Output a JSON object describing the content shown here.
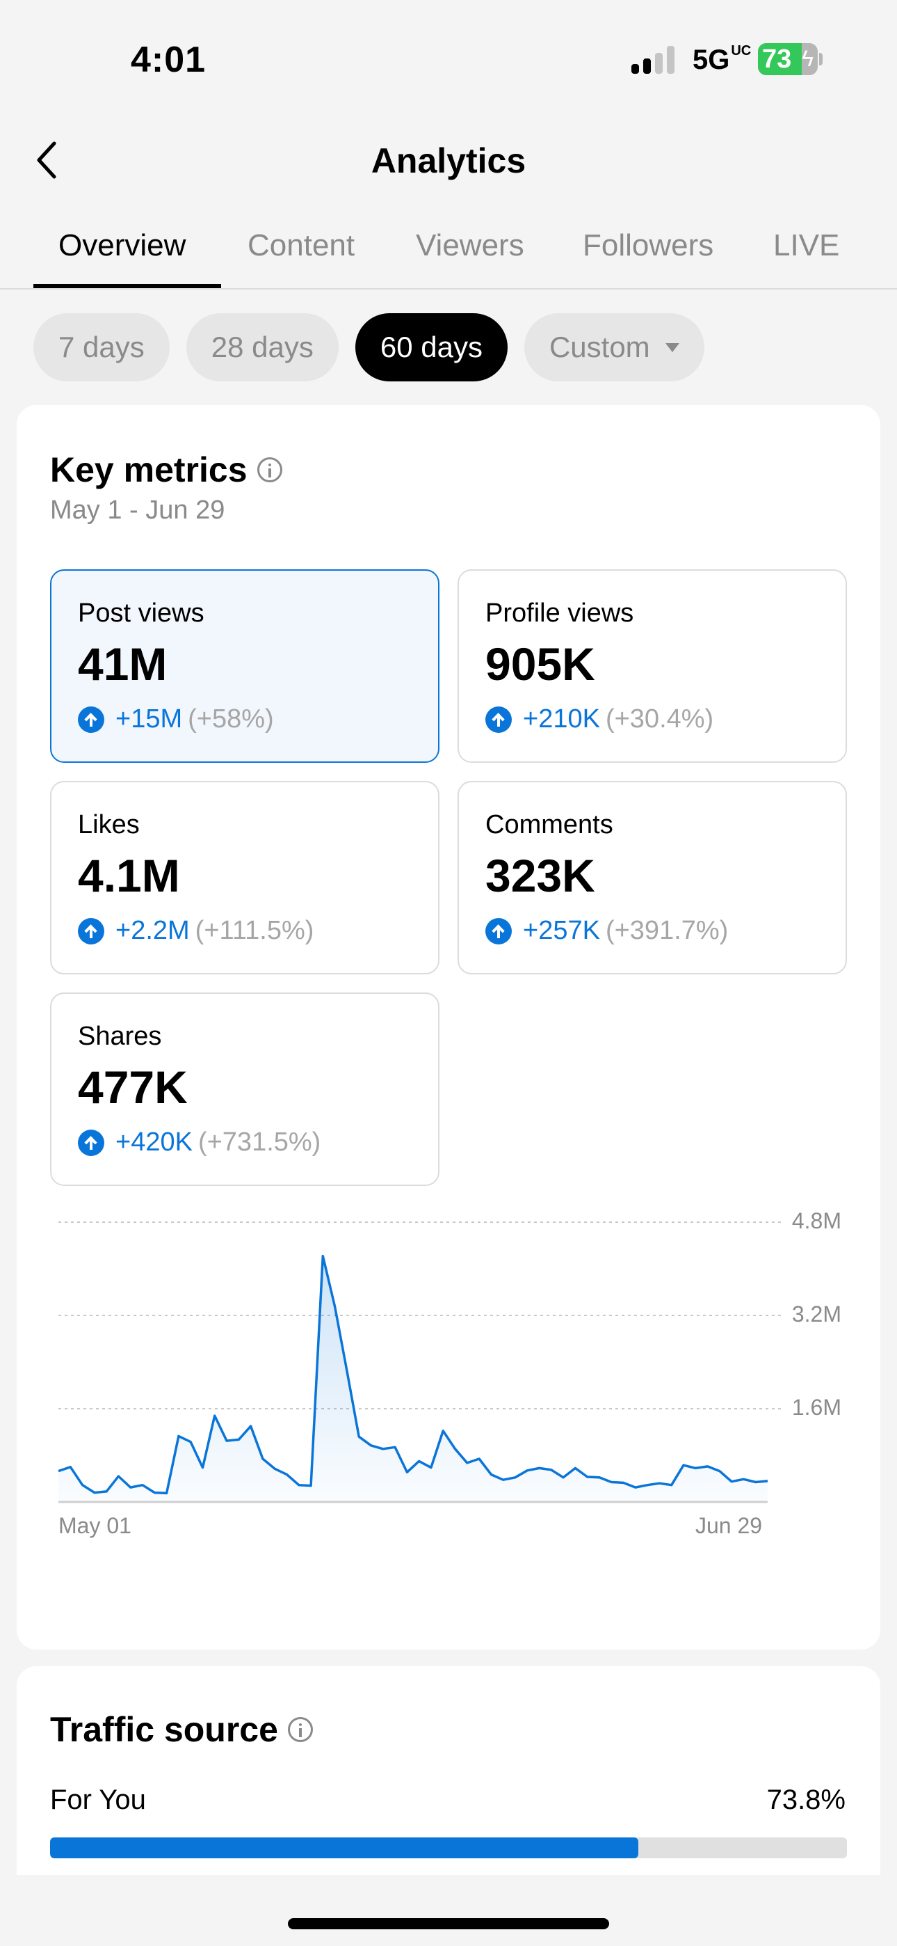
{
  "status_bar": {
    "time": "4:01",
    "network": "5G",
    "network_suffix": "UC",
    "battery_percent": 73,
    "battery_label": "73",
    "charging": true,
    "signal_bars_active": 2,
    "signal_bars_total": 4
  },
  "nav": {
    "title": "Analytics",
    "back_icon": "chevron-left-icon"
  },
  "tabs": [
    {
      "label": "Overview",
      "active": true
    },
    {
      "label": "Content",
      "active": false
    },
    {
      "label": "Viewers",
      "active": false
    },
    {
      "label": "Followers",
      "active": false
    },
    {
      "label": "LIVE",
      "active": false
    }
  ],
  "date_filters": [
    {
      "label": "7 days",
      "active": false
    },
    {
      "label": "28 days",
      "active": false
    },
    {
      "label": "60 days",
      "active": true
    },
    {
      "label": "Custom",
      "active": false,
      "dropdown": true
    }
  ],
  "key_metrics": {
    "title": "Key metrics",
    "date_range": "May 1 - Jun 29",
    "metrics": [
      {
        "label": "Post views",
        "value": "41M",
        "delta": "+15M",
        "delta_pct": "(+58%)",
        "selected": true
      },
      {
        "label": "Profile views",
        "value": "905K",
        "delta": "+210K",
        "delta_pct": "(+30.4%)",
        "selected": false
      },
      {
        "label": "Likes",
        "value": "4.1M",
        "delta": "+2.2M",
        "delta_pct": "(+111.5%)",
        "selected": false
      },
      {
        "label": "Comments",
        "value": "323K",
        "delta": "+257K",
        "delta_pct": "(+391.7%)",
        "selected": false
      },
      {
        "label": "Shares",
        "value": "477K",
        "delta": "+420K",
        "delta_pct": "(+731.5%)",
        "selected": false
      }
    ]
  },
  "chart_data": {
    "type": "area",
    "title": "Post views",
    "xlabel": "",
    "ylabel": "",
    "x_tick_labels": [
      "May 01",
      "Jun 29"
    ],
    "y_tick_labels": [
      "1.6M",
      "3.2M",
      "4.8M"
    ],
    "y_ticks": [
      1.6,
      3.2,
      4.8
    ],
    "ylim": [
      0,
      4.8
    ],
    "units": "millions",
    "grid": true,
    "color": "#0a75d9",
    "values": [
      0.53,
      0.6,
      0.29,
      0.16,
      0.18,
      0.44,
      0.25,
      0.29,
      0.16,
      0.15,
      1.13,
      1.03,
      0.59,
      1.48,
      1.05,
      1.07,
      1.3,
      0.74,
      0.57,
      0.47,
      0.29,
      0.28,
      4.22,
      3.35,
      2.25,
      1.12,
      0.97,
      0.91,
      0.94,
      0.51,
      0.7,
      0.59,
      1.22,
      0.91,
      0.67,
      0.74,
      0.47,
      0.38,
      0.42,
      0.54,
      0.58,
      0.55,
      0.42,
      0.58,
      0.43,
      0.42,
      0.34,
      0.33,
      0.25,
      0.29,
      0.32,
      0.29,
      0.63,
      0.58,
      0.61,
      0.53,
      0.35,
      0.39,
      0.34,
      0.36
    ]
  },
  "traffic_source": {
    "title": "Traffic source",
    "rows": [
      {
        "label": "For You",
        "value": "73.8%",
        "percent": 73.8
      }
    ]
  },
  "colors": {
    "accent": "#0a75d9",
    "battery_green": "#34c759",
    "muted_text": "#8a8a8a"
  }
}
